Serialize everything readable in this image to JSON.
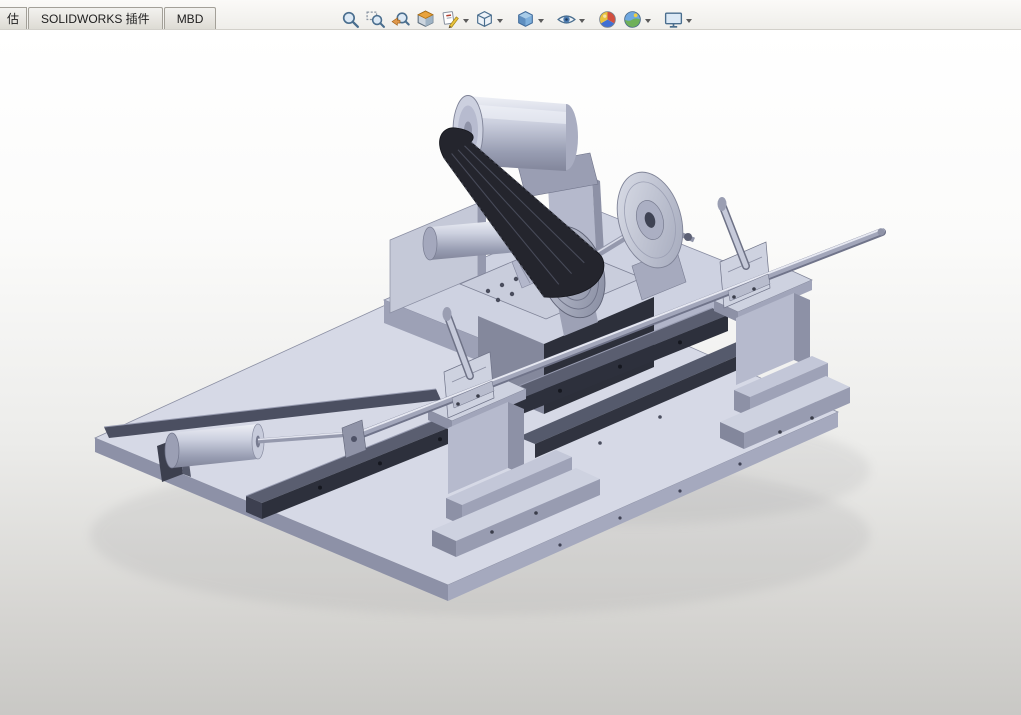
{
  "command_tabs": [
    {
      "label": "估"
    },
    {
      "label": "SOLIDWORKS 插件"
    },
    {
      "label": "MBD"
    }
  ],
  "headsup_toolbar": {
    "icons": [
      {
        "name": "zoom-to-fit-icon",
        "dropdown": false
      },
      {
        "name": "zoom-to-area-icon",
        "dropdown": false
      },
      {
        "name": "previous-view-icon",
        "dropdown": false
      },
      {
        "name": "section-view-icon",
        "dropdown": false
      },
      {
        "name": "dynamic-annotation-views-icon",
        "dropdown": true
      },
      {
        "name": "view-orientation-icon",
        "dropdown": true
      },
      {
        "name": "display-style-icon",
        "dropdown": true
      },
      {
        "name": "hide-show-items-icon",
        "dropdown": true
      },
      {
        "name": "edit-appearance-icon",
        "dropdown": false
      },
      {
        "name": "apply-scene-icon",
        "dropdown": true
      },
      {
        "name": "view-settings-icon",
        "dropdown": true
      }
    ]
  },
  "viewport": {
    "model_parts": [
      "base-plate",
      "left-guide-rail",
      "front-guide-rail",
      "rear-guide-rail",
      "left-cylinder",
      "raised-platform",
      "fence-plate",
      "roller-cylinder",
      "gearbox",
      "motor",
      "motor-pulley",
      "drive-belt",
      "drive-pulley",
      "cutting-disc",
      "spindle-shaft",
      "long-rod",
      "center-stand",
      "center-toggle-clamp",
      "right-stand",
      "right-toggle-clamp"
    ],
    "background_top": "#ffffff",
    "background_bottom": "#c9c8c5"
  },
  "colors": {
    "model_light": "#d6d9e6",
    "model_mid": "#aab0c4",
    "model_dark": "#2d303c",
    "belt": "#24252d",
    "tab_bar_bg": "#efeeea",
    "icon_blue": "#4a6e8e",
    "section_orange": "#e8a33d"
  }
}
